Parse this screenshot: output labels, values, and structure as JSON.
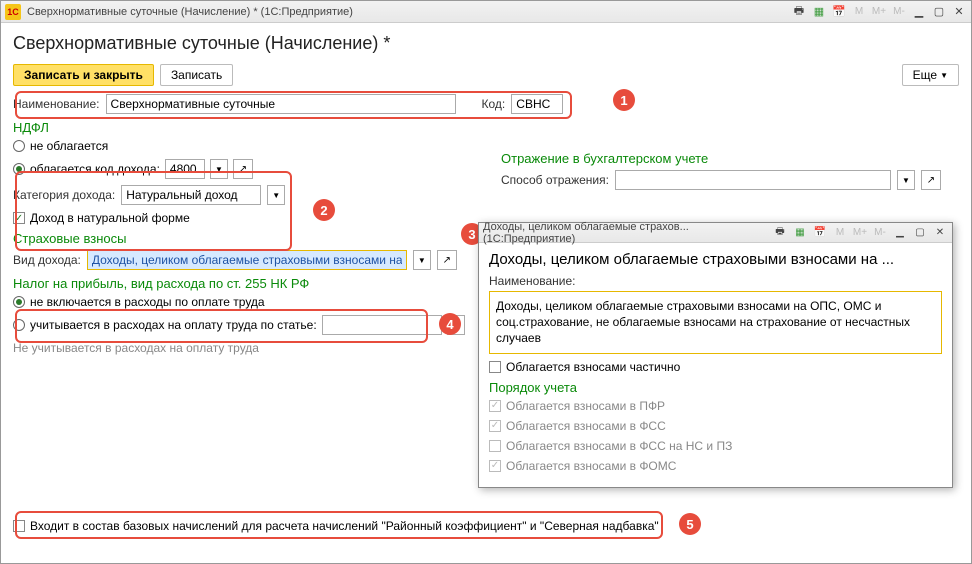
{
  "window": {
    "title": "Сверхнормативные суточные (Начисление) *  (1С:Предприятие)"
  },
  "header": {
    "title": "Сверхнормативные суточные (Начисление) *"
  },
  "buttons": {
    "save_close": "Записать и закрыть",
    "save": "Записать",
    "more": "Еще"
  },
  "fields": {
    "name_label": "Наименование:",
    "name_value": "Сверхнормативные суточные",
    "code_label": "Код:",
    "code_value": "СВНС"
  },
  "ndfl": {
    "heading": "НДФЛ",
    "none": "не облагается",
    "taxed": "облагается  код дохода:",
    "code_value": "4800",
    "cat_label": "Категория дохода:",
    "cat_value": "Натуральный доход",
    "natural": "Доход в натуральной форме"
  },
  "acct": {
    "heading": "Отражение в бухгалтерском учете",
    "way_label": "Способ отражения:"
  },
  "insur": {
    "heading": "Страховые взносы",
    "kind_label": "Вид дохода:",
    "kind_value": "Доходы, целиком облагаемые страховыми взносами на ОПС"
  },
  "profit": {
    "heading": "Налог на прибыль, вид расхода по ст. 255 НК РФ",
    "opt1": "не включается в расходы по оплате труда",
    "opt2": "учитывается в расходах на оплату труда по статье:",
    "note": "Не учитывается в расходах на оплату труда"
  },
  "footer": {
    "base": "Входит в состав базовых начислений для расчета начислений \"Районный коэффициент\" и \"Северная надбавка\""
  },
  "popup": {
    "title": "Доходы, целиком облагаемые страхов... (1С:Предприятие)",
    "h2": "Доходы, целиком облагаемые страховыми взносами на ...",
    "name_label": "Наименование:",
    "name_value": "Доходы, целиком облагаемые страховыми взносами на ОПС, ОМС и соц.страхование, не облагаемые взносами на страхование от несчастных случаев",
    "partial": "Облагается взносами частично",
    "order": "Порядок учета",
    "pfr": "Облагается взносами в ПФР",
    "fss": "Облагается взносами в ФСС",
    "fss_ns": "Облагается взносами в ФСС на НС и ПЗ",
    "foms": "Облагается взносами в ФОМС"
  },
  "badges": {
    "b1": "1",
    "b2": "2",
    "b3": "3",
    "b4": "4",
    "b5": "5"
  }
}
